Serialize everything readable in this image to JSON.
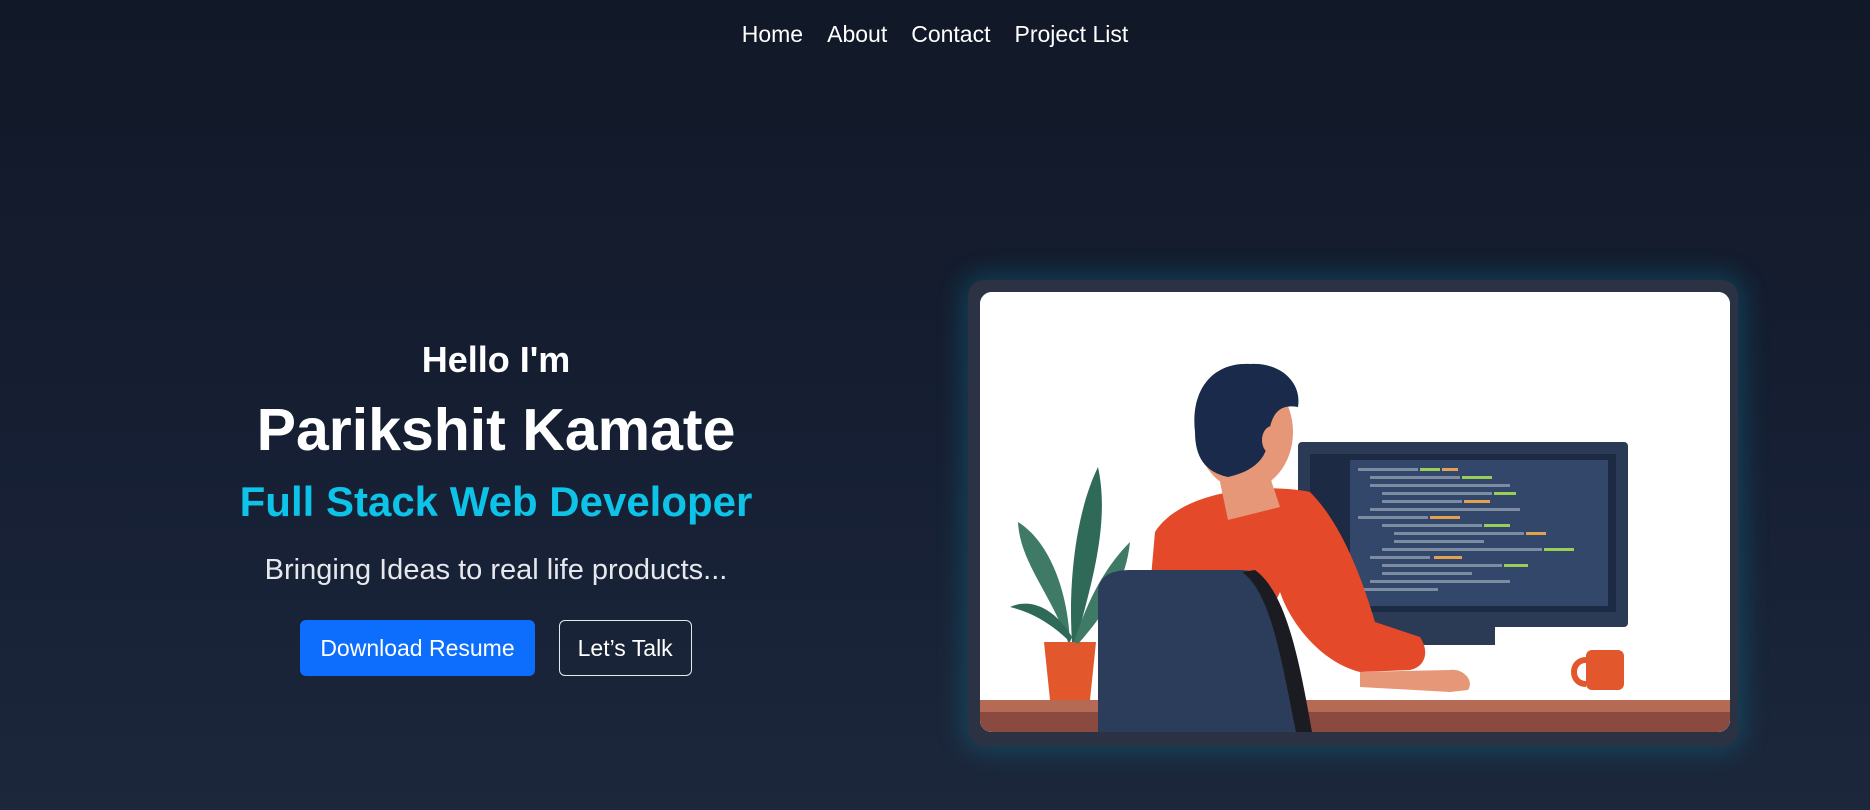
{
  "nav": {
    "items": [
      {
        "label": "Home"
      },
      {
        "label": "About"
      },
      {
        "label": "Contact"
      },
      {
        "label": "Project List"
      }
    ]
  },
  "hero": {
    "greeting": "Hello I'm",
    "name": "Parikshit Kamate",
    "role": "Full Stack Web Developer",
    "tagline": "Bringing Ideas to real life products...",
    "primary_button": "Download Resume",
    "secondary_button": "Let’s Talk"
  },
  "illustration": {
    "icon": "developer-at-desk-illustration"
  },
  "colors": {
    "background": "#111827",
    "accent": "#0ec3e8",
    "primary_button": "#0d6efd"
  }
}
